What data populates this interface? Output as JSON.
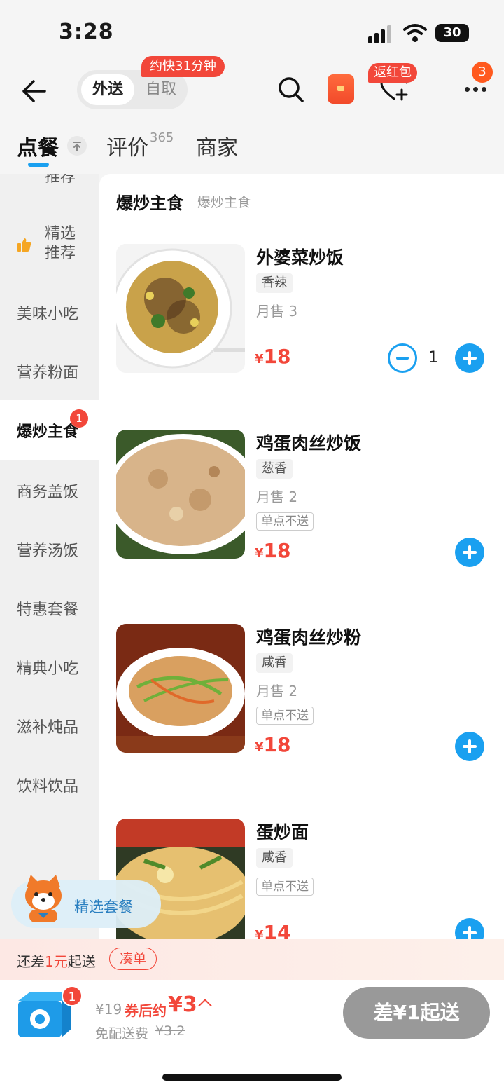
{
  "status": {
    "time": "3:28",
    "battery": "30"
  },
  "header": {
    "mode_active": "外送",
    "mode_inactive": "自取",
    "eta_badge": "约快31分钟",
    "fav_badge": "返红包",
    "more_badge": "3"
  },
  "tabs": [
    {
      "label": "点餐"
    },
    {
      "label": "评价",
      "count": "365"
    },
    {
      "label": "商家"
    }
  ],
  "sidebar": {
    "items": [
      {
        "label": "推荐"
      },
      {
        "label": "精选\n推荐"
      },
      {
        "label": "美味小吃"
      },
      {
        "label": "营养粉面"
      },
      {
        "label": "爆炒主食",
        "badge": "1"
      },
      {
        "label": "商务盖饭"
      },
      {
        "label": "营养汤饭"
      },
      {
        "label": "特惠套餐"
      },
      {
        "label": "精典小吃"
      },
      {
        "label": "滋补炖品"
      },
      {
        "label": "饮料饮品"
      }
    ]
  },
  "section": {
    "title": "爆炒主食",
    "subtitle": "爆炒主食"
  },
  "items": [
    {
      "name": "外婆菜炒饭",
      "tag": "香辣",
      "sold": "月售 3",
      "price": "18",
      "qty": "1"
    },
    {
      "name": "鸡蛋肉丝炒饭",
      "tag": "葱香",
      "sold": "月售 2",
      "note": "单点不送",
      "price": "18"
    },
    {
      "name": "鸡蛋肉丝炒粉",
      "tag": "咸香",
      "sold": "月售 2",
      "note": "单点不送",
      "price": "18"
    },
    {
      "name": "蛋炒面",
      "tag": "咸香",
      "note": "单点不送",
      "price": "14"
    }
  ],
  "currency": "¥",
  "promo": {
    "label": "精选套餐"
  },
  "notice": {
    "prefix": "还差",
    "amount": "1元",
    "suffix": "起送",
    "action": "凑单"
  },
  "cart": {
    "badge": "1",
    "original": "¥19",
    "after_label": "券后约",
    "after_value": "¥3",
    "free_label": "免配送费",
    "free_old": "¥3.2",
    "button": "差¥1起送"
  },
  "colors": {
    "accent": "#1aa0f0",
    "price": "#f2473a"
  }
}
